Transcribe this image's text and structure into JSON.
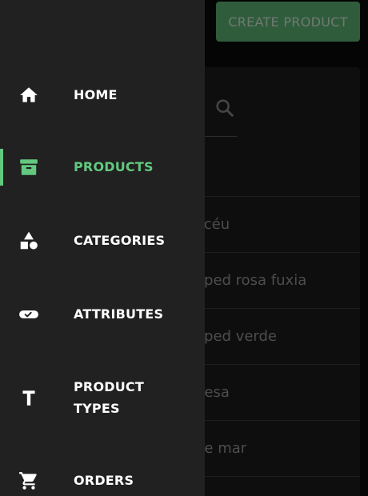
{
  "header": {
    "create_button_label": "CREATE PRODUCT"
  },
  "search": {
    "icon": "search-icon"
  },
  "product_rows": [
    "l céu",
    "oped rosa fuxia",
    "oped verde",
    "uesa",
    "de mar"
  ],
  "nav": {
    "items": [
      {
        "label": "HOME",
        "icon": "home-icon",
        "active": false
      },
      {
        "label": "PRODUCTS",
        "icon": "archive-icon",
        "active": true
      },
      {
        "label": "CATEGORIES",
        "icon": "shapes-icon",
        "active": false
      },
      {
        "label": "ATTRIBUTES",
        "icon": "toggle-check-icon",
        "active": false
      },
      {
        "label_line1": "PRODUCT",
        "label_line2": "TYPES",
        "icon": "text-t-icon",
        "active": false
      },
      {
        "label": "ORDERS",
        "icon": "cart-icon",
        "active": false
      }
    ]
  },
  "colors": {
    "accent": "#62c97f",
    "button": "#5fb877",
    "drawer": "#212121",
    "text": "#ffffff"
  }
}
